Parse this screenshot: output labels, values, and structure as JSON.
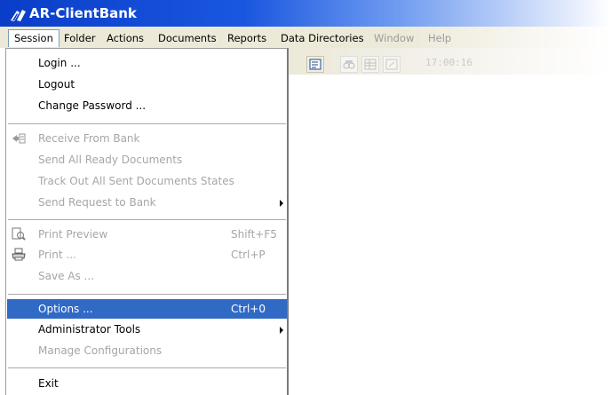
{
  "window": {
    "title": "AR-ClientBank"
  },
  "menubar": {
    "items": [
      {
        "label": "Session",
        "disabled": false,
        "active": true
      },
      {
        "label": "Folder",
        "disabled": false
      },
      {
        "label": "Actions",
        "disabled": false
      },
      {
        "label": "Documents",
        "disabled": false
      },
      {
        "label": "Reports",
        "disabled": false
      },
      {
        "label": "Data Directories",
        "disabled": false
      },
      {
        "label": "Window",
        "disabled": true
      },
      {
        "label": "Help",
        "disabled": true
      }
    ]
  },
  "toolbar": {
    "time_text": "17:00:16"
  },
  "session_menu": {
    "items": [
      {
        "label": "Login ...",
        "disabled": false
      },
      {
        "label": "Logout",
        "disabled": false
      },
      {
        "label": "Change Password ...",
        "disabled": false
      },
      {
        "label": "Receive From Bank",
        "disabled": true,
        "icon": "receive-from-bank-icon"
      },
      {
        "label": "Send All Ready Documents",
        "disabled": true
      },
      {
        "label": "Track Out All Sent Documents States",
        "disabled": true
      },
      {
        "label": "Send Request to Bank",
        "disabled": true,
        "submenu": true
      },
      {
        "label": "Print Preview",
        "shortcut": "Shift+F5",
        "disabled": true,
        "icon": "print-preview-icon"
      },
      {
        "label": "Print ...",
        "shortcut": "Ctrl+P",
        "disabled": true,
        "icon": "printer-icon"
      },
      {
        "label": "Save As ...",
        "disabled": true
      },
      {
        "label": "Options ...",
        "shortcut": "Ctrl+0",
        "disabled": false,
        "selected": true
      },
      {
        "label": "Administrator Tools",
        "disabled": false,
        "submenu": true
      },
      {
        "label": "Manage Configurations",
        "disabled": true
      },
      {
        "label": "Exit",
        "disabled": false
      }
    ]
  },
  "colors": {
    "title_bar": "#0a3dc8",
    "menu_bg": "#ece9d8",
    "selection": "#316ac5",
    "disabled_text": "#a6a6a6"
  }
}
